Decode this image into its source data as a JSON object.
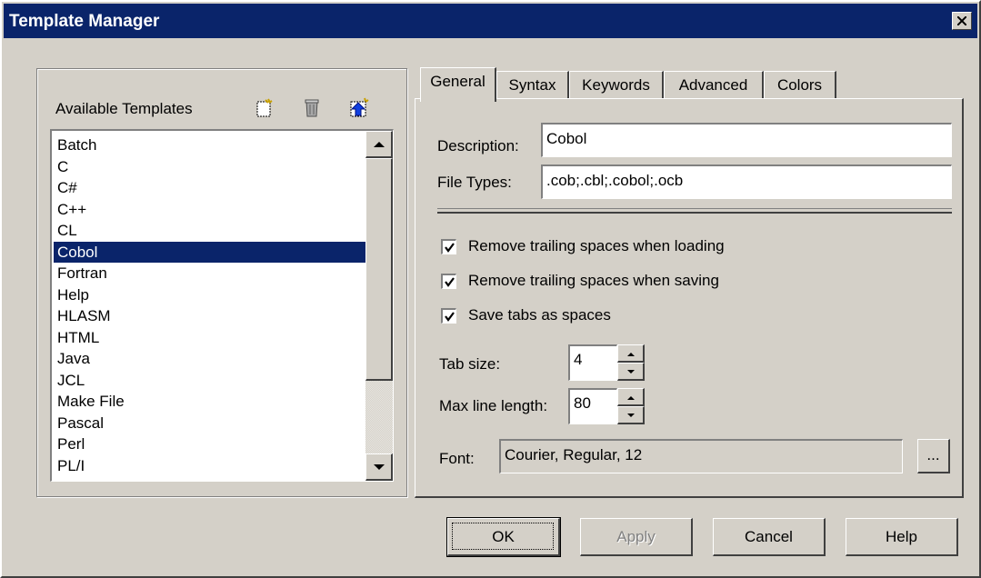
{
  "window": {
    "title": "Template Manager"
  },
  "templates": {
    "label": "Available Templates",
    "toolbar_icons": [
      "new-template-icon",
      "delete-template-icon",
      "import-template-icon"
    ],
    "items": [
      "Batch",
      "C",
      "C#",
      "C++",
      "CL",
      "Cobol",
      "Fortran",
      "Help",
      "HLASM",
      "HTML",
      "Java",
      "JCL",
      "Make File",
      "Pascal",
      "Perl",
      "PL/I"
    ],
    "selected": "Cobol"
  },
  "tabs": [
    {
      "label": "General",
      "active": true
    },
    {
      "label": "Syntax",
      "active": false
    },
    {
      "label": "Keywords",
      "active": false
    },
    {
      "label": "Advanced",
      "active": false
    },
    {
      "label": "Colors",
      "active": false
    }
  ],
  "general": {
    "description_label": "Description:",
    "description_value": "Cobol",
    "filetypes_label": "File Types:",
    "filetypes_value": ".cob;.cbl;.cobol;.ocb",
    "checkboxes": [
      {
        "label": "Remove trailing spaces when loading",
        "checked": true
      },
      {
        "label": "Remove trailing spaces when saving",
        "checked": true
      },
      {
        "label": "Save tabs as spaces",
        "checked": true
      }
    ],
    "tabsize_label": "Tab size:",
    "tabsize_value": "4",
    "maxline_label": "Max line length:",
    "maxline_value": "80",
    "font_label": "Font:",
    "font_value": "Courier, Regular, 12",
    "font_button": "..."
  },
  "buttons": {
    "ok": "OK",
    "apply": "Apply",
    "cancel": "Cancel",
    "help": "Help"
  },
  "colors": {
    "titlebar": "#0a246a",
    "selection": "#0a246a",
    "face": "#d4d0c8"
  }
}
